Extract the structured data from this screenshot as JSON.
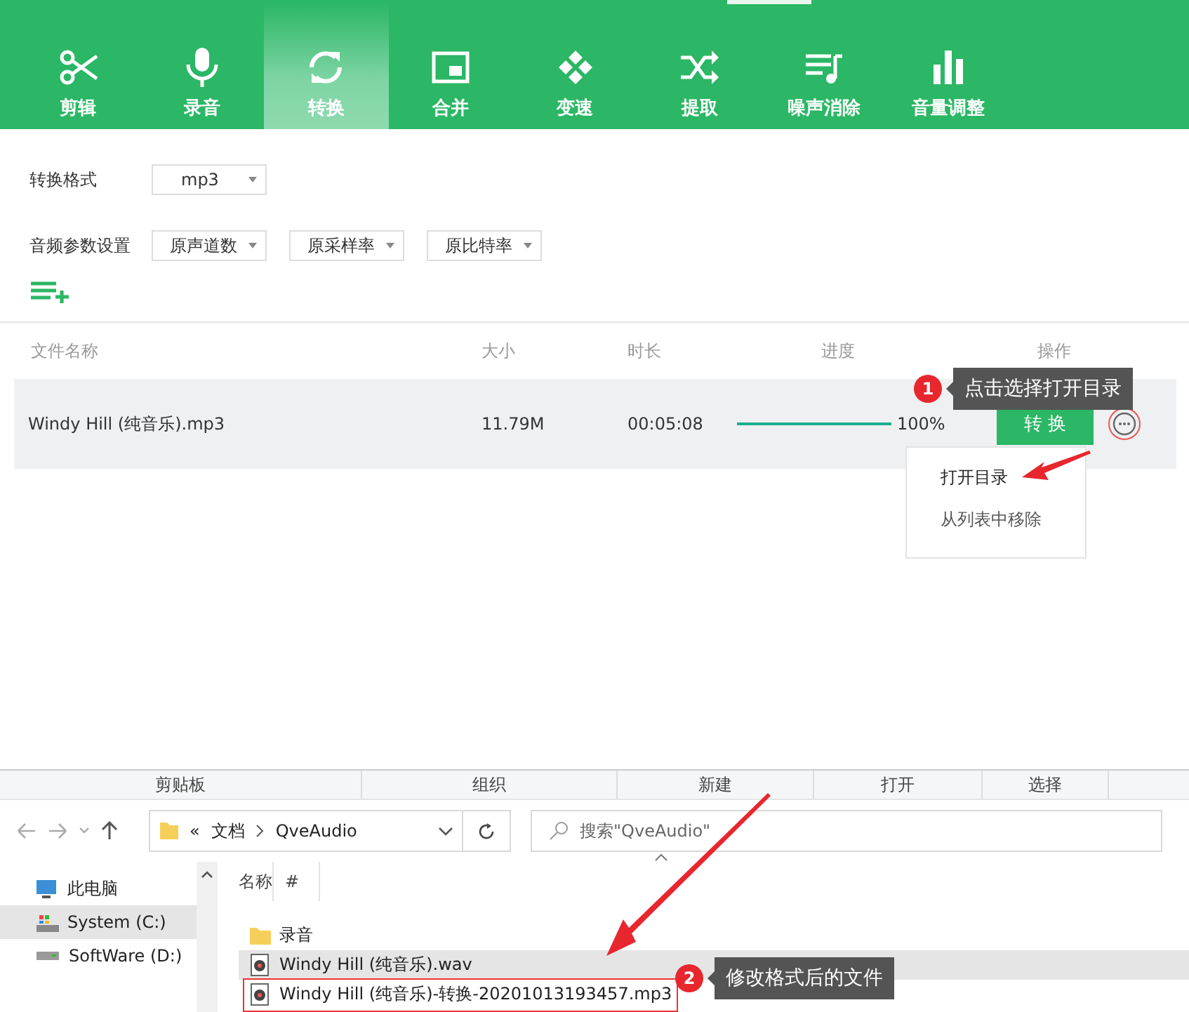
{
  "toolbar": {
    "tools": [
      {
        "label": "剪辑",
        "selected": false
      },
      {
        "label": "录音",
        "selected": false
      },
      {
        "label": "转换",
        "selected": true
      },
      {
        "label": "合并",
        "selected": false
      },
      {
        "label": "变速",
        "selected": false
      },
      {
        "label": "提取",
        "selected": false
      },
      {
        "label": "噪声消除",
        "selected": false
      },
      {
        "label": "音量调整",
        "selected": false
      }
    ]
  },
  "settings": {
    "format": {
      "label": "转换格式",
      "value": "mp3"
    },
    "audio_params": {
      "label": "音频参数设置",
      "dropdowns": [
        "原声道数",
        "原采样率",
        "原比特率"
      ]
    }
  },
  "table": {
    "columns": [
      "文件名称",
      "大小",
      "时长",
      "进度",
      "操作"
    ],
    "rows": [
      {
        "name": "Windy Hill (纯音乐).mp3",
        "size": "11.79M",
        "duration": "00:05:08",
        "level": 1,
        "progress": "100%",
        "action": "转 换"
      }
    ]
  },
  "row_menu": {
    "items": [
      "打开目录",
      "从列表中移除"
    ]
  },
  "annotations": [
    {
      "number": "1",
      "text": "点击选择打开目录"
    },
    {
      "number": "2",
      "text": "修改格式后的文件"
    }
  ],
  "explorer": {
    "ribbon_groups": [
      "剪贴板",
      "组织",
      "新建",
      "打开",
      "选择"
    ],
    "breadcrumb": {
      "overflow": "«",
      "path": [
        "文档",
        "QveAudio"
      ]
    },
    "search": {
      "placeholder": "搜索\"QveAudio\""
    },
    "nav": [
      {
        "label": "此电脑",
        "selected": false
      },
      {
        "label": "System (C:)",
        "selected": true
      },
      {
        "label": "SoftWare (D:)",
        "selected": false
      }
    ],
    "columns": [
      "名称",
      "#"
    ],
    "files": [
      {
        "name": "录音",
        "kind": "folder",
        "selected": false,
        "highlighted": false
      },
      {
        "name": "Windy Hill (纯音乐).wav",
        "kind": "audio",
        "selected": true,
        "highlighted": false
      },
      {
        "name": "Windy Hill (纯音乐)-转换-20201013193457.mp3",
        "kind": "audio",
        "selected": false,
        "highlighted": true
      }
    ]
  }
}
